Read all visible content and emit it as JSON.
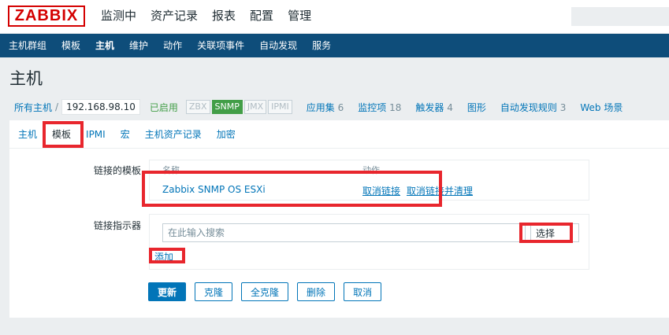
{
  "logo": "ZABBIX",
  "top_menu": [
    "监测中",
    "资产记录",
    "报表",
    "配置",
    "管理"
  ],
  "sub_menu": [
    "主机群组",
    "模板",
    "主机",
    "维护",
    "动作",
    "关联项事件",
    "自动发现",
    "服务"
  ],
  "page_title": "主机",
  "host_nav": {
    "all_hosts": "所有主机",
    "separator": "/",
    "host_name": "192.168.98.10",
    "status": "已启用",
    "availability": [
      "ZBX",
      "SNMP",
      "JMX",
      "IPMI"
    ],
    "items": [
      {
        "label": "应用集",
        "count": "6"
      },
      {
        "label": "监控项",
        "count": "18"
      },
      {
        "label": "触发器",
        "count": "4"
      },
      {
        "label": "图形",
        "count": ""
      },
      {
        "label": "自动发现规则",
        "count": "3"
      },
      {
        "label": "Web 场景",
        "count": ""
      }
    ]
  },
  "tabs": [
    "主机",
    "模板",
    "IPMI",
    "宏",
    "主机资产记录",
    "加密"
  ],
  "form": {
    "linked_templates_label": "链接的模板",
    "col_name": "名称",
    "col_action": "动作",
    "template_name": "Zabbix SNMP OS ESXi",
    "unlink": "取消链接",
    "unlink_clear": "取消链接并清理",
    "link_new_label": "链接指示器",
    "search_placeholder": "在此输入搜索",
    "select_button": "选择",
    "add_link": "添加"
  },
  "buttons": [
    "更新",
    "克隆",
    "全克隆",
    "删除",
    "取消"
  ],
  "colors": {
    "nav_bg": "#0e4d7a",
    "link": "#0275b8",
    "enabled": "#429e47",
    "highlight": "#e8262d",
    "logo": "#d40000"
  }
}
